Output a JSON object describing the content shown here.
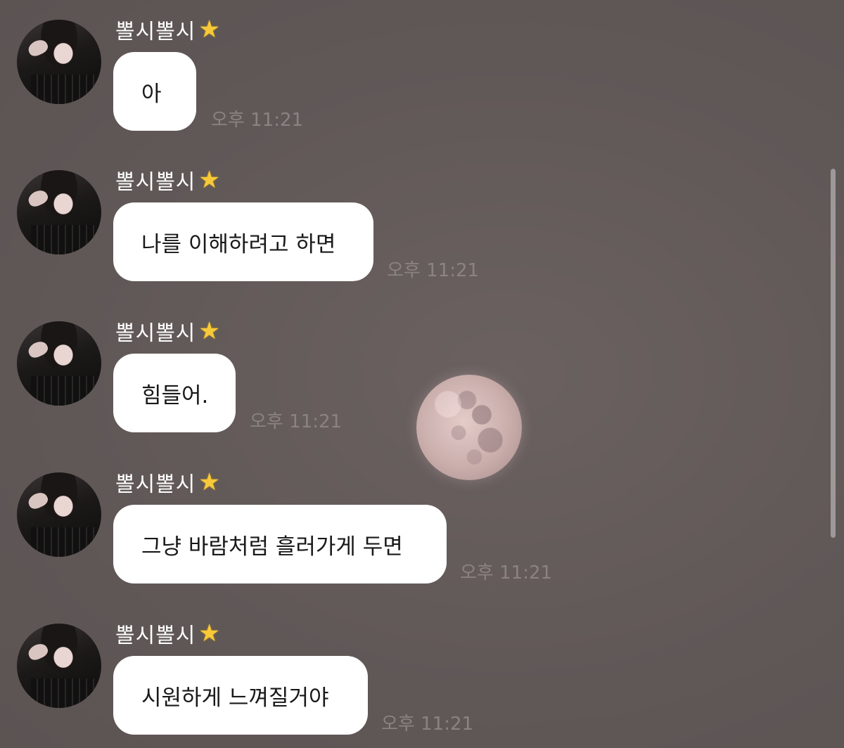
{
  "colors": {
    "background": "#635a59",
    "bubble": "#ffffff",
    "bubble_text": "#191919",
    "sender_name": "#ffffff",
    "timestamp": "#8a8382",
    "star": "#f7c93a"
  },
  "messages": [
    {
      "sender": "뽈시뽈시",
      "badge_icon": "star-icon",
      "text": "아",
      "time": "오후 11:21"
    },
    {
      "sender": "뽈시뽈시",
      "badge_icon": "star-icon",
      "text": "나를 이해하려고 하면",
      "time": "오후 11:21"
    },
    {
      "sender": "뽈시뽈시",
      "badge_icon": "star-icon",
      "text": "힘들어.",
      "time": "오후 11:21"
    },
    {
      "sender": "뽈시뽈시",
      "badge_icon": "star-icon",
      "text": "그냥 바람처럼 흘러가게 두면",
      "time": "오후 11:21"
    },
    {
      "sender": "뽈시뽈시",
      "badge_icon": "star-icon",
      "text": "시원하게 느껴질거야",
      "time": "오후 11:21"
    }
  ]
}
